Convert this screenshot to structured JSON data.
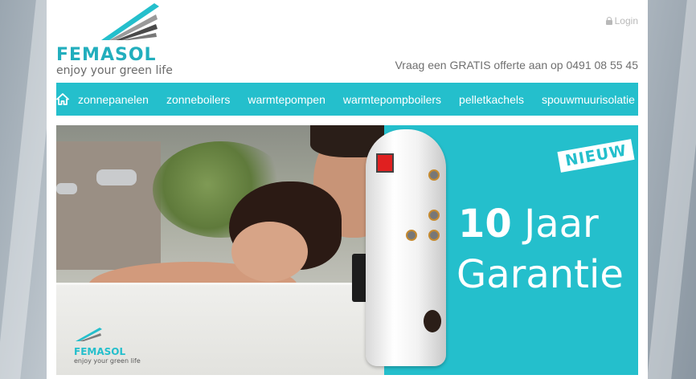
{
  "brand": {
    "name": "FEMASOL",
    "tagline": "enjoy your green life",
    "color": "#24bfcc"
  },
  "header": {
    "login_label": "Login",
    "login_icon": "lock-icon",
    "phone_text": "Vraag een GRATIS offerte aan op 0491 08 55 45"
  },
  "nav": {
    "home_icon": "home-icon",
    "items": [
      {
        "label": "zonnepanelen"
      },
      {
        "label": "zonneboilers"
      },
      {
        "label": "warmtepompen"
      },
      {
        "label": "warmtepompboilers"
      },
      {
        "label": "pelletkachels"
      },
      {
        "label": "spouwmuurisolatie"
      }
    ]
  },
  "hero": {
    "badge": "NIEUW",
    "headline_number": "10",
    "headline_word": "Jaar",
    "headline_line2": "Garantie",
    "small_logo_name": "FEMASOL",
    "small_logo_tagline": "enjoy your green life"
  }
}
